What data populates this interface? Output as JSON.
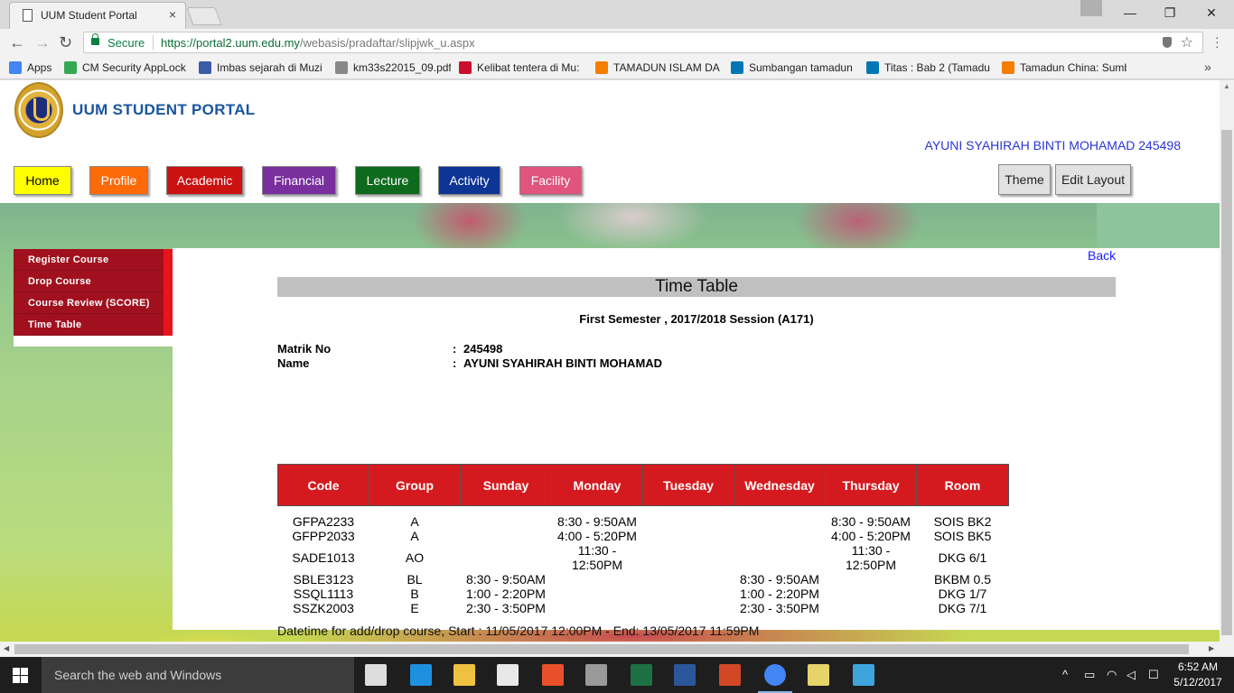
{
  "browser": {
    "tab_title": "UUM Student Portal",
    "tab_close": "×",
    "window_controls": {
      "minimize": "—",
      "maximize": "❐",
      "close": "✕"
    },
    "secure_label": "Secure",
    "url_host": "https://portal2.uum.edu.my",
    "url_path": "/webasis/pradaftar/slipjwk_u.aspx",
    "bookmarks": [
      {
        "label": "Apps",
        "icon": "apps-grid-icon",
        "color": "#4285f4"
      },
      {
        "label": "CM Security AppLock",
        "icon": "play-store-icon",
        "color": "#34a853"
      },
      {
        "label": "Imbas sejarah di Muzi",
        "icon": "globe-icon",
        "color": "#3b5ba5"
      },
      {
        "label": "km33s22015_09.pdf",
        "icon": "document-icon",
        "color": "#888888"
      },
      {
        "label": "Kelibat tentera di Mu:",
        "icon": "sinar-harian-icon",
        "color": "#c8102e"
      },
      {
        "label": "TAMADUN ISLAM DA",
        "icon": "blogger-icon",
        "color": "#f57d00"
      },
      {
        "label": "Sumbangan tamadun",
        "icon": "linkedin-icon",
        "color": "#0077b5"
      },
      {
        "label": "Titas : Bab 2 (Tamadu",
        "icon": "linkedin-icon",
        "color": "#0077b5"
      },
      {
        "label": "Tamadun China: Sumb",
        "icon": "blogger-icon",
        "color": "#f57d00"
      }
    ],
    "bookmarks_more": "»"
  },
  "header": {
    "portal_title": "UUM STUDENT PORTAL",
    "user_name": "AYUNI SYAHIRAH BINTI MOHAMAD 245498"
  },
  "nav": [
    {
      "label": "Home",
      "color": "#ffff00",
      "text_color": "#000000"
    },
    {
      "label": "Profile",
      "color": "#ff6a08",
      "text_color": "#ffffff"
    },
    {
      "label": "Academic",
      "color": "#cc1111",
      "text_color": "#ffffff"
    },
    {
      "label": "Financial",
      "color": "#7a2f9e",
      "text_color": "#ffffff"
    },
    {
      "label": "Lecture",
      "color": "#0e6b1d",
      "text_color": "#ffffff"
    },
    {
      "label": "Activity",
      "color": "#0c3596",
      "text_color": "#ffffff"
    },
    {
      "label": "Facility",
      "color": "#e0547e",
      "text_color": "#ffffff"
    }
  ],
  "layout_buttons": {
    "theme": "Theme",
    "edit_layout": "Edit Layout"
  },
  "side_menu": [
    "Register Course",
    "Drop Course",
    "Course Review (SCORE)",
    "Time Table"
  ],
  "timetable": {
    "back": "Back",
    "title": "Time Table",
    "semester": "First Semester , 2017/2018 Session (A171)",
    "matrik_label": "Matrik No",
    "matrik_value": "245498",
    "name_label": "Name",
    "name_value": "AYUNI SYAHIRAH BINTI MOHAMAD",
    "colon": ":",
    "headers": [
      "Code",
      "Group",
      "Sunday",
      "Monday",
      "Tuesday",
      "Wednesday",
      "Thursday",
      "Room"
    ],
    "rows": [
      [
        "GFPA2233",
        "A",
        "",
        "8:30 - 9:50AM",
        "",
        "",
        "8:30 - 9:50AM",
        "SOIS BK2"
      ],
      [
        "GFPP2033",
        "A",
        "",
        "4:00 - 5:20PM",
        "",
        "",
        "4:00 - 5:20PM",
        "SOIS BK5"
      ],
      [
        "SADE1013",
        "AO",
        "",
        "11:30 - 12:50PM",
        "",
        "",
        "11:30 - 12:50PM",
        "DKG 6/1"
      ],
      [
        "SBLE3123",
        "BL",
        "8:30 - 9:50AM",
        "",
        "",
        "8:30 - 9:50AM",
        "",
        "BKBM 0.5"
      ],
      [
        "SSQL1113",
        "B",
        "1:00 - 2:20PM",
        "",
        "",
        "1:00 - 2:20PM",
        "",
        "DKG 1/7"
      ],
      [
        "SSZK2003",
        "E",
        "2:30 - 3:50PM",
        "",
        "",
        "2:30 - 3:50PM",
        "",
        "DKG 7/1"
      ]
    ],
    "footer": "Datetime for add/drop course, Start : 11/05/2017 12:00PM - End: 13/05/2017 11:59PM"
  },
  "taskbar": {
    "search_placeholder": "Search the web and Windows",
    "time": "6:52 AM",
    "date": "5/12/2017",
    "apps": [
      {
        "name": "task-view-icon",
        "color": "#dddddd"
      },
      {
        "name": "edge-icon",
        "color": "#1e90e0"
      },
      {
        "name": "file-explorer-icon",
        "color": "#f0c040"
      },
      {
        "name": "store-icon",
        "color": "#e8e8e8"
      },
      {
        "name": "app-red-icon",
        "color": "#e8502c"
      },
      {
        "name": "calculator-icon",
        "color": "#9a9a9a"
      },
      {
        "name": "excel-icon",
        "color": "#1d7044"
      },
      {
        "name": "word-icon",
        "color": "#2b579a"
      },
      {
        "name": "powerpoint-icon",
        "color": "#d24726"
      },
      {
        "name": "chrome-icon",
        "color": "#4285f4"
      },
      {
        "name": "folder-icon",
        "color": "#e6d36a"
      },
      {
        "name": "movie-maker-icon",
        "color": "#3fa4dc"
      }
    ]
  }
}
